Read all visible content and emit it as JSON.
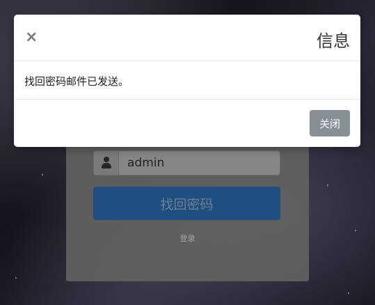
{
  "login": {
    "username_value": "admin",
    "submit_label": "找回密码",
    "login_link": "登录"
  },
  "modal": {
    "close_symbol": "×",
    "title": "信息",
    "message": "找回密码邮件已发送。",
    "close_button": "关闭"
  },
  "colors": {
    "primary": "#1f4f80",
    "secondary": "#868e96"
  }
}
